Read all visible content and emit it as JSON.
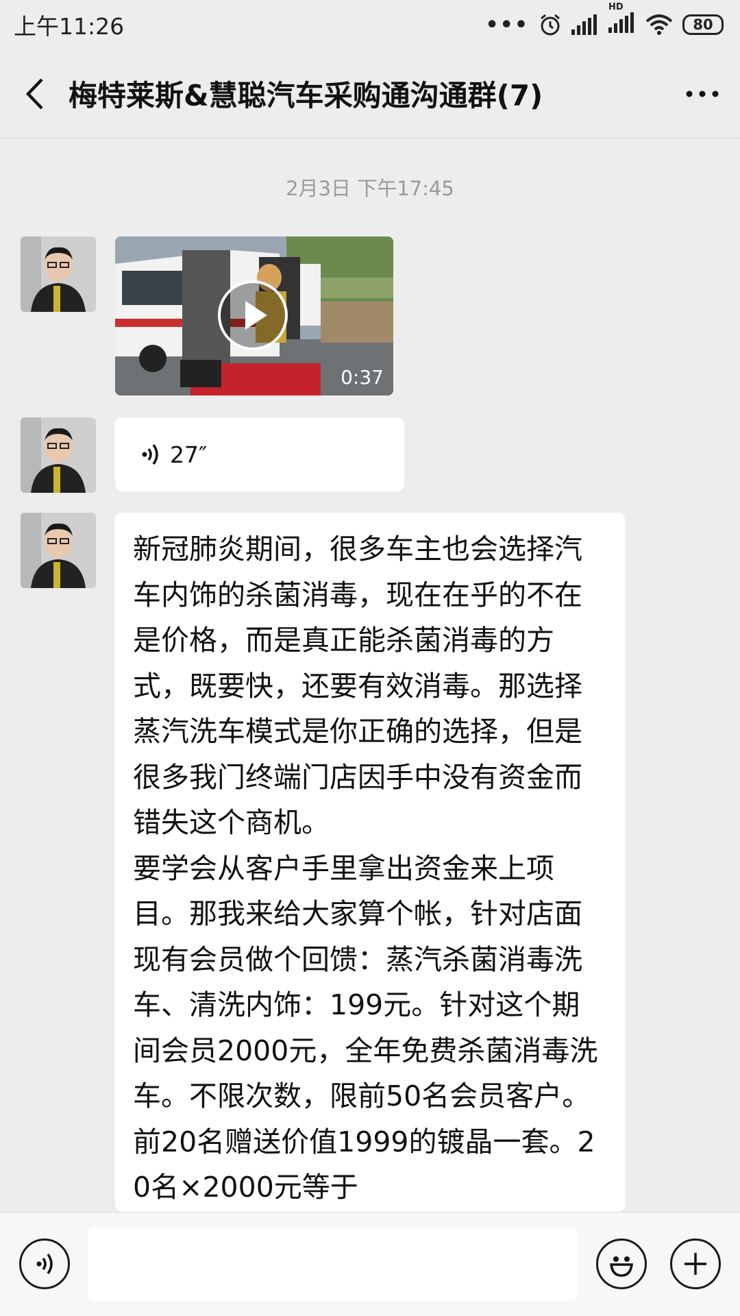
{
  "status_bar": {
    "time": "上午11:26",
    "battery": "80",
    "network_badge": "HD"
  },
  "header": {
    "title": "梅特莱斯&慧聪汽车采购通沟通群(7)"
  },
  "chat": {
    "timestamp": "2月3日 下午17:45",
    "messages": [
      {
        "type": "video",
        "duration": "0:37"
      },
      {
        "type": "voice",
        "duration": "27″"
      },
      {
        "type": "text",
        "text": "新冠肺炎期间，很多车主也会选择汽车内饰的杀菌消毒，现在在乎的不在是价格，而是真正能杀菌消毒的方式，既要快，还要有效消毒。那选择蒸汽洗车模式是你正确的选择，但是很多我门终端门店因手中没有资金而错失这个商机。\n要学会从客户手里拿出资金来上项目。那我来给大家算个帐，针对店面现有会员做个回馈：蒸汽杀菌消毒洗车、清洗内饰：199元。针对这个期间会员2000元，全年免费杀菌消毒洗车。不限次数，限前50名会员客户。前20名赠送价值1999的镀晶一套。20名×2000元等于"
      }
    ]
  },
  "input_bar": {
    "placeholder": ""
  },
  "colors": {
    "background": "#ededed",
    "bubble": "#ffffff",
    "timestamp": "#9a9a9a"
  }
}
